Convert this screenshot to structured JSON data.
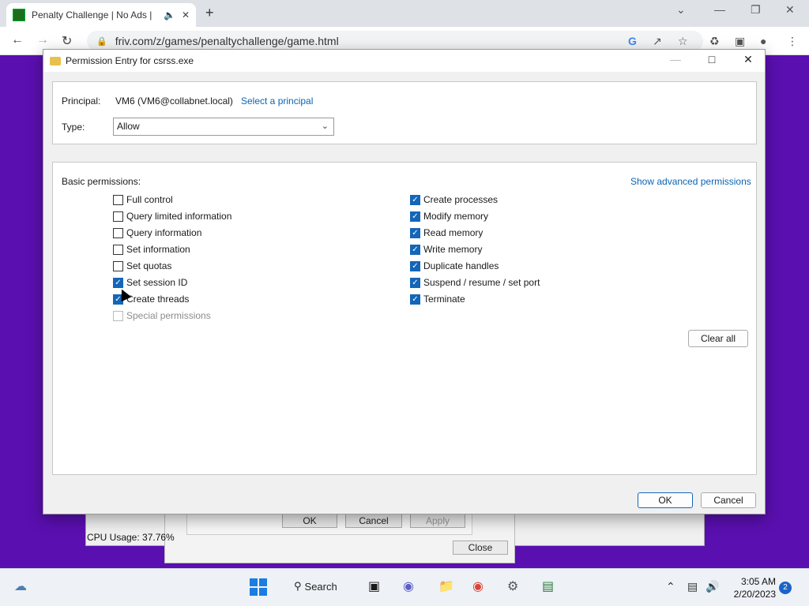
{
  "browser": {
    "tab_title": "Penalty Challenge | No Ads |",
    "url": "friv.com/z/games/penaltychallenge/game.html"
  },
  "background_windows": {
    "ok_label": "OK",
    "cancel_label": "Cancel",
    "apply_label": "Apply",
    "close_label": "Close",
    "cpu_usage": "CPU Usage: 37.76%"
  },
  "dialog": {
    "title": "Permission Entry for csrss.exe",
    "principal_label": "Principal:",
    "principal_value": "VM6 (VM6@collabnet.local)",
    "select_principal_link": "Select a principal",
    "type_label": "Type:",
    "type_value": "Allow",
    "basic_permissions_label": "Basic permissions:",
    "show_advanced_link": "Show advanced permissions",
    "permissions_left": [
      {
        "label": "Full control",
        "checked": false
      },
      {
        "label": "Query limited information",
        "checked": false
      },
      {
        "label": "Query information",
        "checked": false
      },
      {
        "label": "Set information",
        "checked": false
      },
      {
        "label": "Set quotas",
        "checked": false
      },
      {
        "label": "Set session ID",
        "checked": true
      },
      {
        "label": "Create threads",
        "checked": true
      },
      {
        "label": "Special permissions",
        "checked": false
      }
    ],
    "permissions_right": [
      {
        "label": "Create processes",
        "checked": true
      },
      {
        "label": "Modify memory",
        "checked": true
      },
      {
        "label": "Read memory",
        "checked": true
      },
      {
        "label": "Write memory",
        "checked": true
      },
      {
        "label": "Duplicate handles",
        "checked": true
      },
      {
        "label": "Suspend / resume / set port",
        "checked": true
      },
      {
        "label": "Terminate",
        "checked": true
      }
    ],
    "clear_all_label": "Clear all",
    "ok_label": "OK",
    "cancel_label": "Cancel"
  },
  "taskbar": {
    "search_label": "Search",
    "time": "3:05 AM",
    "date": "2/20/2023",
    "notification_count": "2"
  }
}
